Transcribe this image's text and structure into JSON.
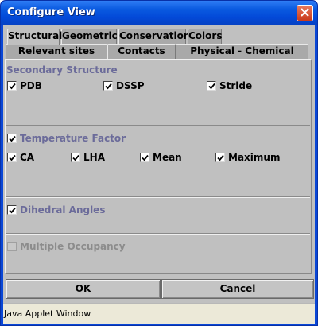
{
  "window": {
    "title": "Configure View"
  },
  "tabs": {
    "row1": [
      "Structural",
      "Geometric",
      "Conservation",
      "Colors"
    ],
    "row2": [
      "Relevant sites",
      "Contacts",
      "Physical - Chemical"
    ],
    "active": "Structural"
  },
  "secondary_structure": {
    "title": "Secondary Structure",
    "options": [
      {
        "label": "PDB",
        "checked": true
      },
      {
        "label": "DSSP",
        "checked": true
      },
      {
        "label": "Stride",
        "checked": true
      }
    ]
  },
  "temperature_factor": {
    "title": "Temperature Factor",
    "checked": true,
    "options": [
      {
        "label": "CA",
        "checked": true
      },
      {
        "label": "LHA",
        "checked": true
      },
      {
        "label": "Mean",
        "checked": true
      },
      {
        "label": "Maximum",
        "checked": true
      }
    ]
  },
  "dihedral_angles": {
    "label": "Dihedral Angles",
    "checked": true
  },
  "multiple_occupancy": {
    "label": "Multiple Occupancy",
    "checked": false,
    "enabled": false
  },
  "buttons": {
    "ok": "OK",
    "cancel": "Cancel"
  },
  "status_bar": {
    "text": "Java Applet Window"
  }
}
